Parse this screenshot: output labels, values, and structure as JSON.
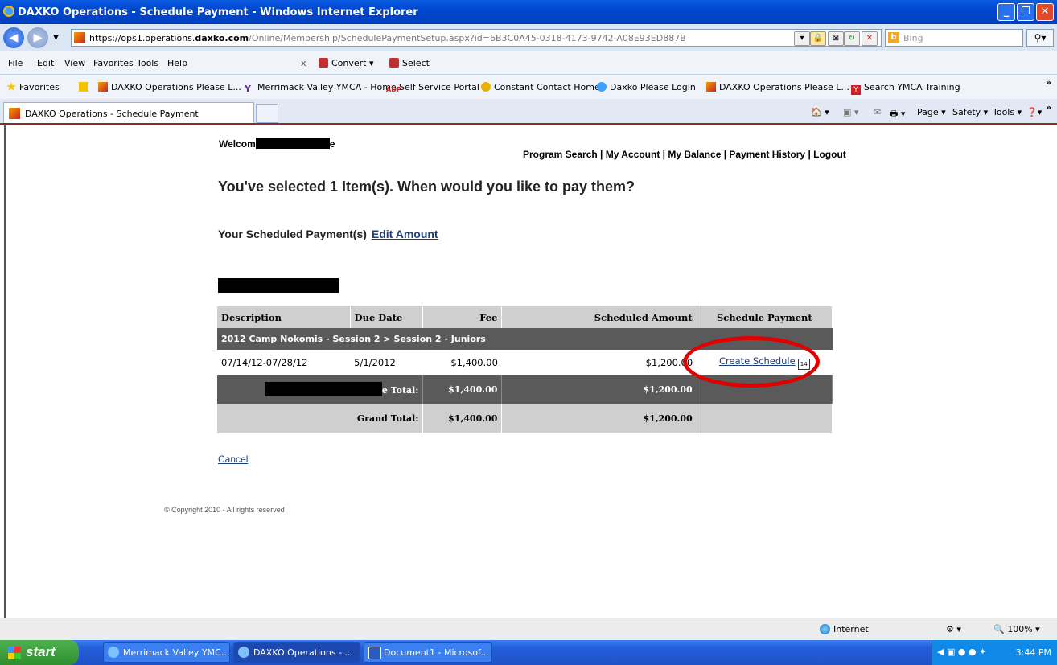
{
  "window": {
    "title": "DAXKO Operations - Schedule Payment - Windows Internet Explorer"
  },
  "address": {
    "url_prefix": "https://ops1.operations.",
    "url_domain": "daxko.com",
    "url_path": "/Online/Membership/SchedulePaymentSetup.aspx?id=6B3C0A45-0318-4173-9742-A08E93ED887B",
    "search_placeholder": "Bing"
  },
  "menu": {
    "items": [
      "File",
      "Edit",
      "View",
      "Favorites",
      "Tools",
      "Help"
    ],
    "convert_label": "Convert",
    "select_label": "Select"
  },
  "favorites_bar": {
    "label": "Favorites",
    "items": [
      "DAXKO Operations  Please L...",
      "Merrimack Valley YMCA - Home",
      "Self Service Portal",
      "Constant Contact Home",
      "Daxko  Please Login",
      "DAXKO Operations  Please L...",
      "Search YMCA Training"
    ]
  },
  "tabs": {
    "active_tab": "DAXKO Operations - Schedule Payment",
    "commands": [
      "Page",
      "Safety",
      "Tools"
    ]
  },
  "page": {
    "welcome_prefix": "Welcom",
    "welcome_suffix": "e",
    "nav": [
      "Program Search",
      "My Account",
      "My Balance",
      "Payment History",
      "Logout"
    ],
    "nav_separator": " | ",
    "headline": "You've selected 1 Item(s). When would you like to pay them?",
    "scheduled_heading": "Your Scheduled Payment(s)",
    "edit_amount_label": "Edit Amount",
    "table": {
      "headers": [
        "Description",
        "Due Date",
        "Fee",
        "Scheduled Amount",
        "Schedule Payment"
      ],
      "group_label": "2012 Camp Nokomis - Session 2 > Session 2 - Juniors",
      "row": {
        "description": "07/14/12-07/28/12",
        "due_date": "5/1/2012",
        "fee": "$1,400.00",
        "scheduled_amount": "$1,200.00",
        "action_label": "Create Schedule",
        "calendar_day": "14"
      },
      "subtotal": {
        "label_suffix": "e Total:",
        "fee": "$1,400.00",
        "scheduled_amount": "$1,200.00"
      },
      "grand_total": {
        "label": "Grand Total:",
        "fee": "$1,400.00",
        "scheduled_amount": "$1,200.00"
      }
    },
    "cancel_label": "Cancel",
    "copyright": "© Copyright 2010 - All rights reserved"
  },
  "status_bar": {
    "zone": "Internet",
    "zoom": "100%"
  },
  "taskbar": {
    "start_label": "start",
    "tasks": [
      "Merrimack Valley YMC...",
      "DAXKO Operations - ...",
      "Document1 - Microsof..."
    ],
    "clock": "3:44 PM"
  },
  "colors": {
    "link": "#1a3f7a",
    "highlight_circle": "#e00000",
    "table_dark": "#5a5a5a",
    "table_light": "#cfcfcf"
  }
}
